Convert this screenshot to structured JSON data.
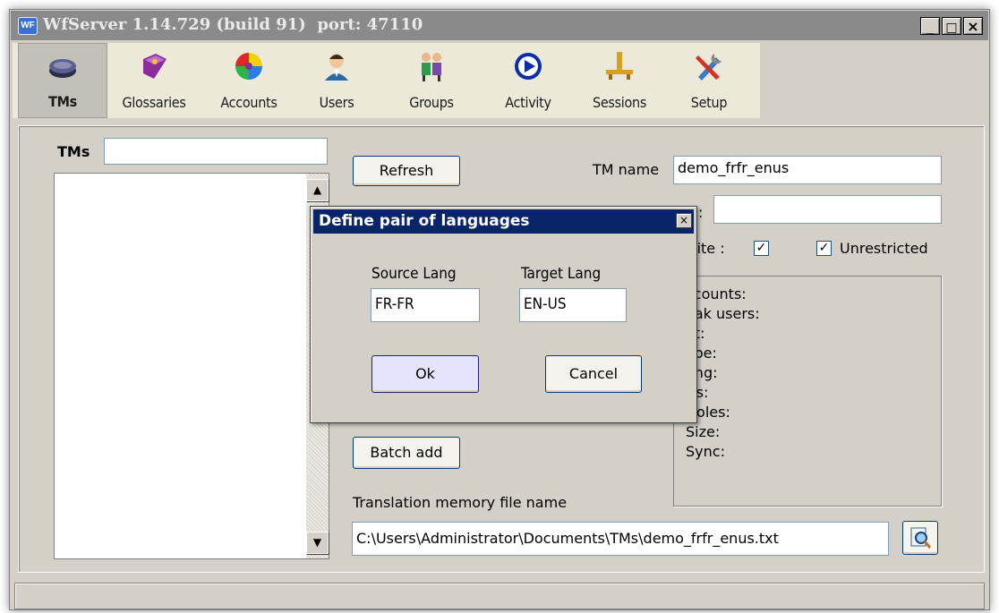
{
  "window": {
    "title": "WfServer 1.14.729 (build 91)  port: 47110",
    "app_icon_text": "WF"
  },
  "toolbar": {
    "items": [
      {
        "label": "TMs",
        "icon": "tm-disc-icon"
      },
      {
        "label": "Glossaries",
        "icon": "glossary-book-icon"
      },
      {
        "label": "Accounts",
        "icon": "color-wheel-icon"
      },
      {
        "label": "Users",
        "icon": "user-person-icon"
      },
      {
        "label": "Groups",
        "icon": "group-people-icon"
      },
      {
        "label": "Activity",
        "icon": "play-circle-icon"
      },
      {
        "label": "Sessions",
        "icon": "network-plug-icon"
      },
      {
        "label": "Setup",
        "icon": "tools-icon"
      }
    ],
    "active": "TMs"
  },
  "tms_panel": {
    "filter_label": "TMs",
    "filter_value": ""
  },
  "buttons": {
    "refresh": "Refresh",
    "batch_add": "Batch add"
  },
  "tm_form": {
    "tm_name_label": "TM name",
    "tm_name_value": "demo_frfr_enus",
    "second_field_label_partial": ":",
    "second_field_value": "",
    "write_label_partial": "rite :",
    "write_checked": true,
    "unrestricted_label": "Unrestricted",
    "unrestricted_checked": true,
    "file_label": "Translation memory file name",
    "file_value": "C:\\Users\\Administrator\\Documents\\TMs\\demo_frfr_enus.txt"
  },
  "info_box": {
    "lines": [
      "ccounts:",
      "eak users:",
      "at:",
      "ype:",
      "ang:",
      "Us:",
      "Holes:",
      "Size:",
      "Sync:"
    ]
  },
  "dialog": {
    "title": "Define pair of languages",
    "close_glyph": "×",
    "source_label": "Source Lang",
    "source_value": "FR-FR",
    "target_label": "Target Lang",
    "target_value": "EN-US",
    "ok_label": "Ok",
    "cancel_label": "Cancel"
  },
  "glyphs": {
    "minimize": "_",
    "maximize": "□",
    "close": "×",
    "check": "✓",
    "scroll_up": "▲",
    "scroll_down": "▼"
  }
}
